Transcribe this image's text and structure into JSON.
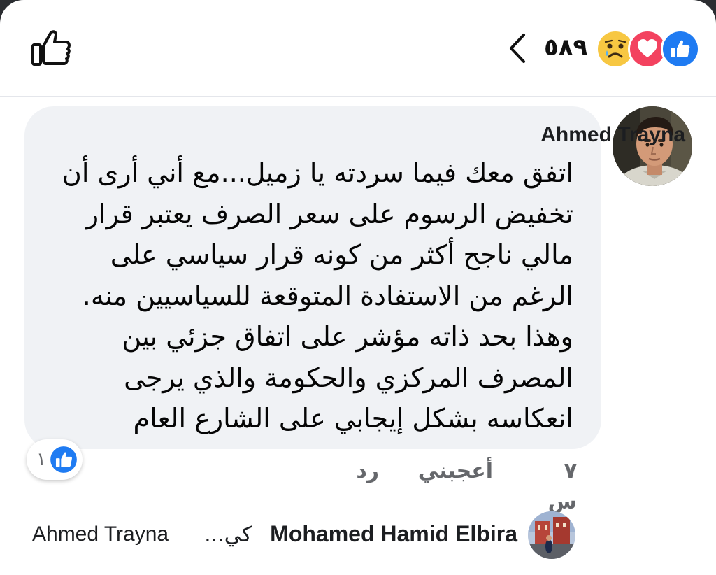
{
  "header": {
    "reaction_count": "٥٨٩",
    "reactions": [
      "sad-icon",
      "love-icon",
      "like-icon"
    ]
  },
  "comment": {
    "author": "Ahmed Trayna",
    "text_lines": [
      "اتفق معك فيما سردته يا زميل...مع أني أرى أن",
      "تخفيض الرسوم على سعر الصرف يعتبر قرار",
      "مالي ناجح أكثر من كونه قرار سياسي على",
      "الرغم من الاستفادة المتوقعة للسياسيين منه.",
      "وهذا بحد ذاته مؤشر على اتفاق جزئي بين",
      "المصرف المركزي والحكومة والذي يرجى",
      "انعكاسه بشكل إيجابي على الشارع العام"
    ],
    "like_count": "١",
    "time": "٧ س",
    "like_label": "أعجبني",
    "reply_label": "رد"
  },
  "reply_preview": {
    "author": "Mohamed Hamid Elbira",
    "snippet": "كي...",
    "mention": "Ahmed Trayna"
  },
  "colors": {
    "like_blue": "#1f7bf2",
    "love_red": "#f3425f",
    "sad_yellow": "#f7c742",
    "bubble_bg": "#f0f2f5",
    "secondary_text": "#65676b"
  }
}
